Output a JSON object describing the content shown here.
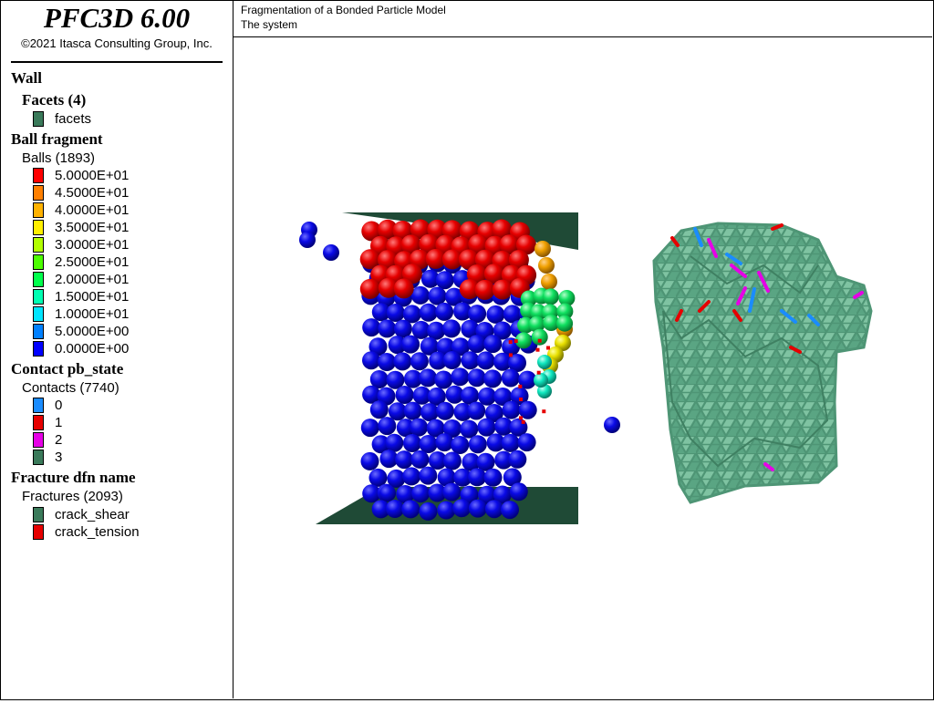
{
  "app": {
    "title": "PFC3D 6.00",
    "copyright": "©2021 Itasca Consulting Group, Inc."
  },
  "header": {
    "line1": "Fragmentation of a Bonded Particle Model",
    "line2": "The system"
  },
  "legend": {
    "wall": {
      "title": "Wall",
      "facets_title": "Facets (4)",
      "items": [
        {
          "label": "facets",
          "color": "#3a7a5a"
        }
      ]
    },
    "ball": {
      "title": "Ball fragment",
      "count": "Balls (1893)",
      "items": [
        {
          "label": "5.0000E+01",
          "color": "#ff0000"
        },
        {
          "label": "4.5000E+01",
          "color": "#ff7f00"
        },
        {
          "label": "4.0000E+01",
          "color": "#ffb200"
        },
        {
          "label": "3.5000E+01",
          "color": "#ffef00"
        },
        {
          "label": "3.0000E+01",
          "color": "#b2ff00"
        },
        {
          "label": "2.5000E+01",
          "color": "#4cff00"
        },
        {
          "label": "2.0000E+01",
          "color": "#00ff4c"
        },
        {
          "label": "1.5000E+01",
          "color": "#00ffb2"
        },
        {
          "label": "1.0000E+01",
          "color": "#00e5ff"
        },
        {
          "label": "5.0000E+00",
          "color": "#0080ff"
        },
        {
          "label": "0.0000E+00",
          "color": "#0000ff"
        }
      ]
    },
    "contact": {
      "title": "Contact pb_state",
      "count": "Contacts (7740)",
      "items": [
        {
          "label": "0",
          "color": "#1a8cff"
        },
        {
          "label": "1",
          "color": "#e60000"
        },
        {
          "label": "2",
          "color": "#e600e6"
        },
        {
          "label": "3",
          "color": "#3a7a5a"
        }
      ]
    },
    "fracture": {
      "title": "Fracture dfn name",
      "count": "Fractures (2093)",
      "items": [
        {
          "label": "crack_shear",
          "color": "#3a7a5a"
        },
        {
          "label": "crack_tension",
          "color": "#e60000"
        }
      ]
    }
  }
}
